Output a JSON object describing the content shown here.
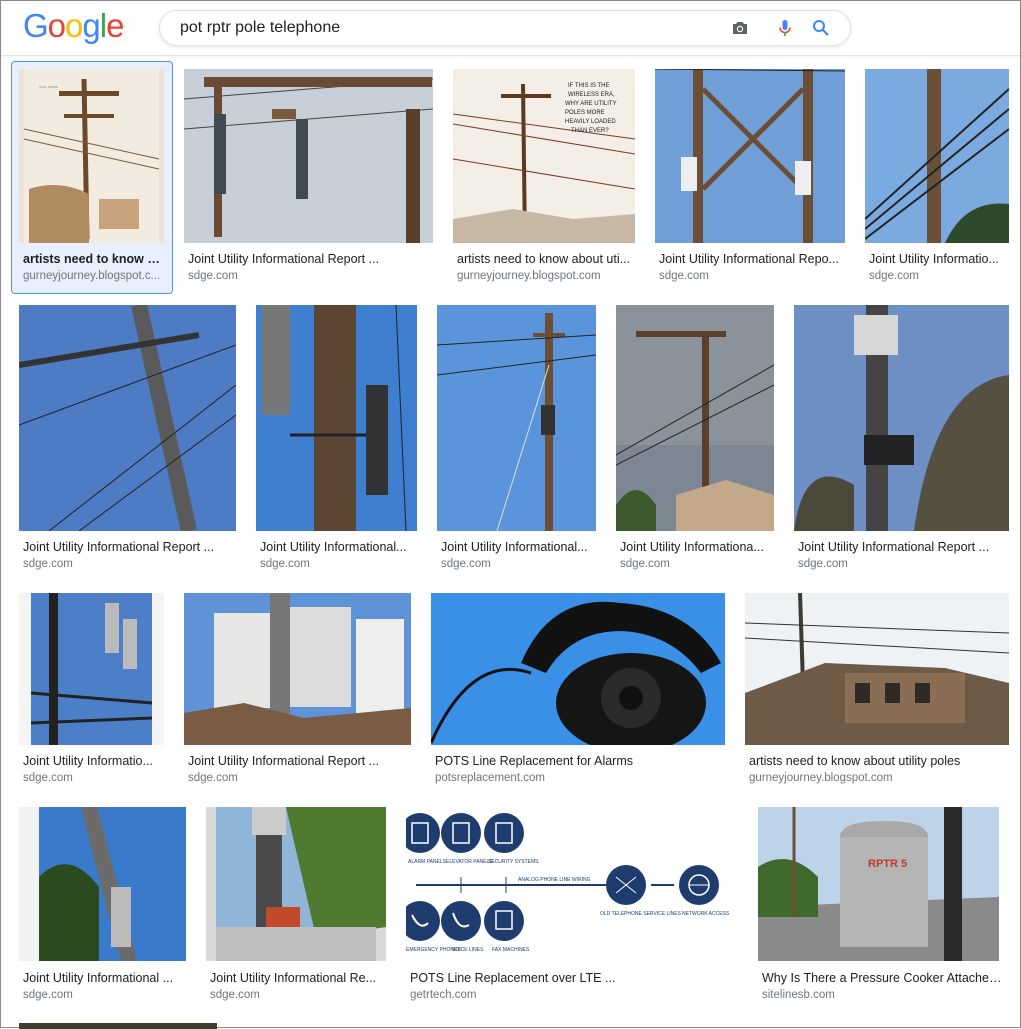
{
  "app": {
    "logo": "Google"
  },
  "search": {
    "query": "pot rptr pole telephone"
  },
  "icons": {
    "camera": "camera-icon",
    "mic": "microphone-icon",
    "search": "search-icon"
  },
  "colors": {
    "accent": "#4285f4",
    "selection": "#e8f0fe"
  },
  "results": [
    {
      "title": "artists need to know a...",
      "source": "gurneyjourney.blogspot.c..."
    },
    {
      "title": "Joint Utility Informational Report ...",
      "source": "sdge.com"
    },
    {
      "title": "artists need to know about uti...",
      "source": "gurneyjourney.blogspot.com"
    },
    {
      "title": "Joint Utility Informational Repo...",
      "source": "sdge.com"
    },
    {
      "title": "Joint Utility Informatio...",
      "source": "sdge.com"
    },
    {
      "title": "Joint Utility Informational Report ...",
      "source": "sdge.com"
    },
    {
      "title": "Joint Utility Informational...",
      "source": "sdge.com"
    },
    {
      "title": "Joint Utility Informational...",
      "source": "sdge.com"
    },
    {
      "title": "Joint Utility Informationa...",
      "source": "sdge.com"
    },
    {
      "title": "Joint Utility Informational Report ...",
      "source": "sdge.com"
    },
    {
      "title": "Joint Utility Informatio...",
      "source": "sdge.com"
    },
    {
      "title": "Joint Utility Informational Report ...",
      "source": "sdge.com"
    },
    {
      "title": "POTS Line Replacement for Alarms",
      "source": "potsreplacement.com"
    },
    {
      "title": "artists need to know about utility poles",
      "source": "gurneyjourney.blogspot.com"
    },
    {
      "title": "Joint Utility Informational ...",
      "source": "sdge.com"
    },
    {
      "title": "Joint Utility Informational Re...",
      "source": "sdge.com"
    },
    {
      "title": "POTS Line Replacement over LTE ...",
      "source": "getrtech.com"
    },
    {
      "title": "Why Is There a Pressure Cooker Attached ...",
      "source": "sitelinesb.com"
    }
  ],
  "infographic": {
    "labels": [
      "ALARM PANELS",
      "ELEVATOR PANELS",
      "SECURITY SYSTEMS",
      "ANALOG PHONE LINE WIRING",
      "OLD TELEPHONE SERVICE LINES",
      "NETWORK ACCESS",
      "EMERGENCY PHONES",
      "VOICE LINES",
      "FAX MACHINES"
    ]
  },
  "pole_marking": "RPTR 5"
}
